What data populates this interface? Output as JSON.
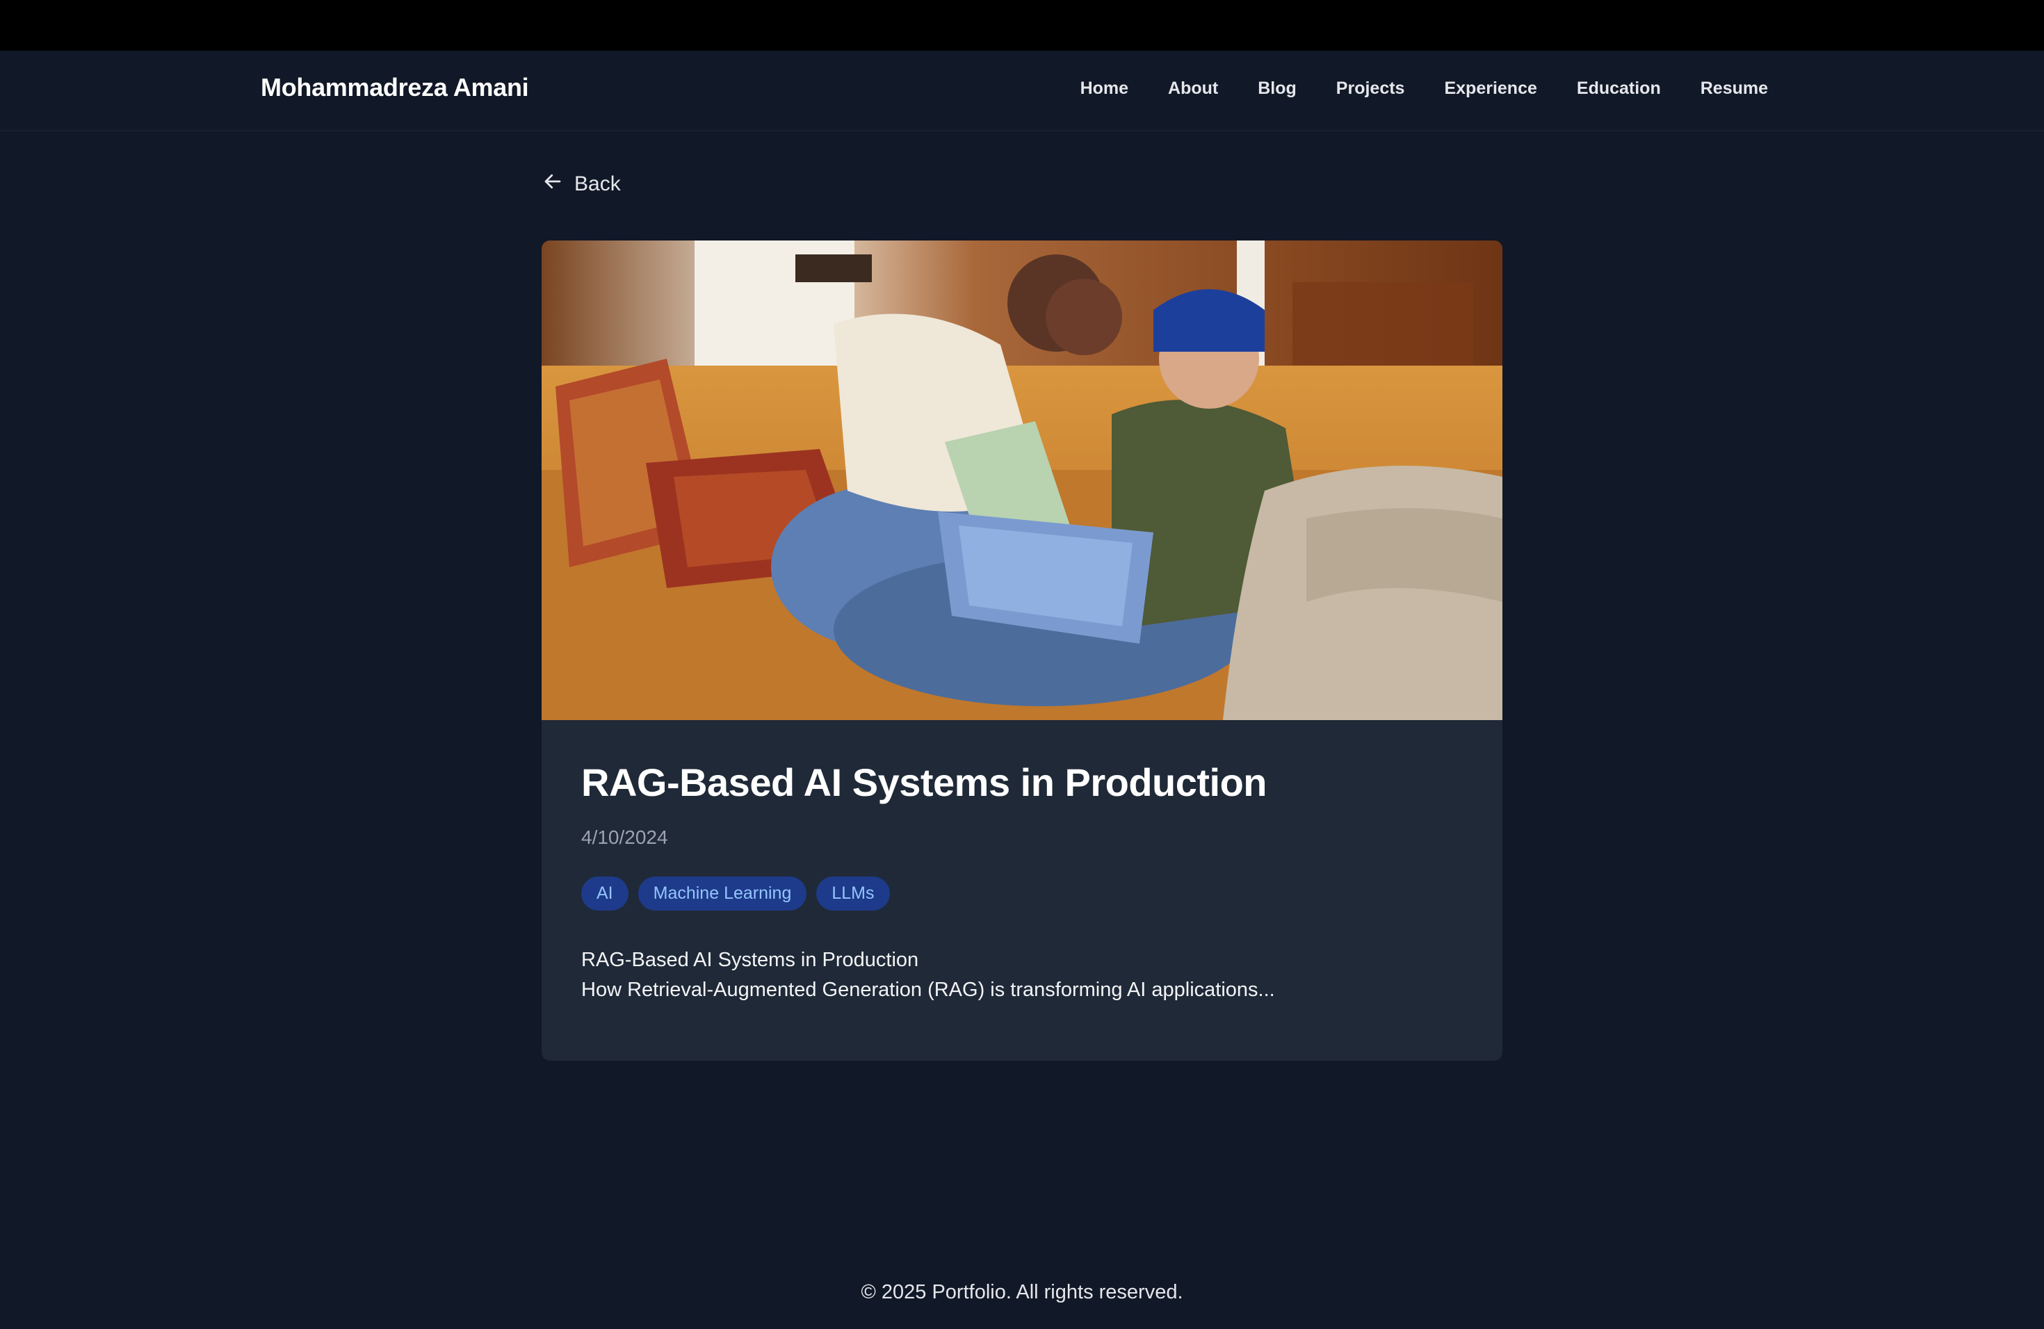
{
  "site": {
    "brand": "Mohammadreza Amani"
  },
  "nav": {
    "items": [
      {
        "label": "Home"
      },
      {
        "label": "About"
      },
      {
        "label": "Blog"
      },
      {
        "label": "Projects"
      },
      {
        "label": "Experience"
      },
      {
        "label": "Education"
      },
      {
        "label": "Resume"
      }
    ]
  },
  "back": {
    "label": "Back",
    "icon": "arrow-left-icon"
  },
  "post": {
    "title": "RAG-Based AI Systems in Production",
    "date": "4/10/2024",
    "tags": [
      "AI",
      "Machine Learning",
      "LLMs"
    ],
    "excerpt_line1": "RAG-Based AI Systems in Production",
    "excerpt_line2": "How Retrieval-Augmented Generation (RAG) is transforming AI applications..."
  },
  "footer": {
    "text": "© 2025 Portfolio. All rights reserved."
  },
  "colors": {
    "background": "#111827",
    "card": "#1f2937",
    "tag_bg": "#1e3a8a",
    "tag_text": "#93c5fd",
    "muted": "#9ca3af"
  }
}
